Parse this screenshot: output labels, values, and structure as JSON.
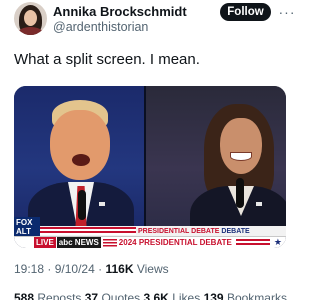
{
  "author": {
    "name": "Annika Brockschmidt",
    "handle": "@ardenthistorian",
    "follow_label": "Follow",
    "more_icon": "ellipsis-icon"
  },
  "tweet": {
    "text": "What a split screen. I mean."
  },
  "media": {
    "network_logo": "FOX ALT",
    "banner_label": "PRESIDENTIAL DEBATE",
    "banner_label_short": "DEBATE",
    "live_label": "LIVE",
    "abc_label": "abc NEWS",
    "ticker_text": "2024 PRESIDENTIAL DEBATE",
    "star_icon": "star-icon"
  },
  "meta": {
    "time": "19:18",
    "date": "9/10/24",
    "views_count": "116K",
    "views_label": "Views"
  },
  "stats": {
    "reposts_count": "588",
    "reposts_label": "Reposts",
    "quotes_count": "37",
    "quotes_label": "Quotes",
    "likes_count": "3.6K",
    "likes_label": "Likes",
    "bookmarks_count": "139",
    "bookmarks_label": "Bookmarks"
  }
}
